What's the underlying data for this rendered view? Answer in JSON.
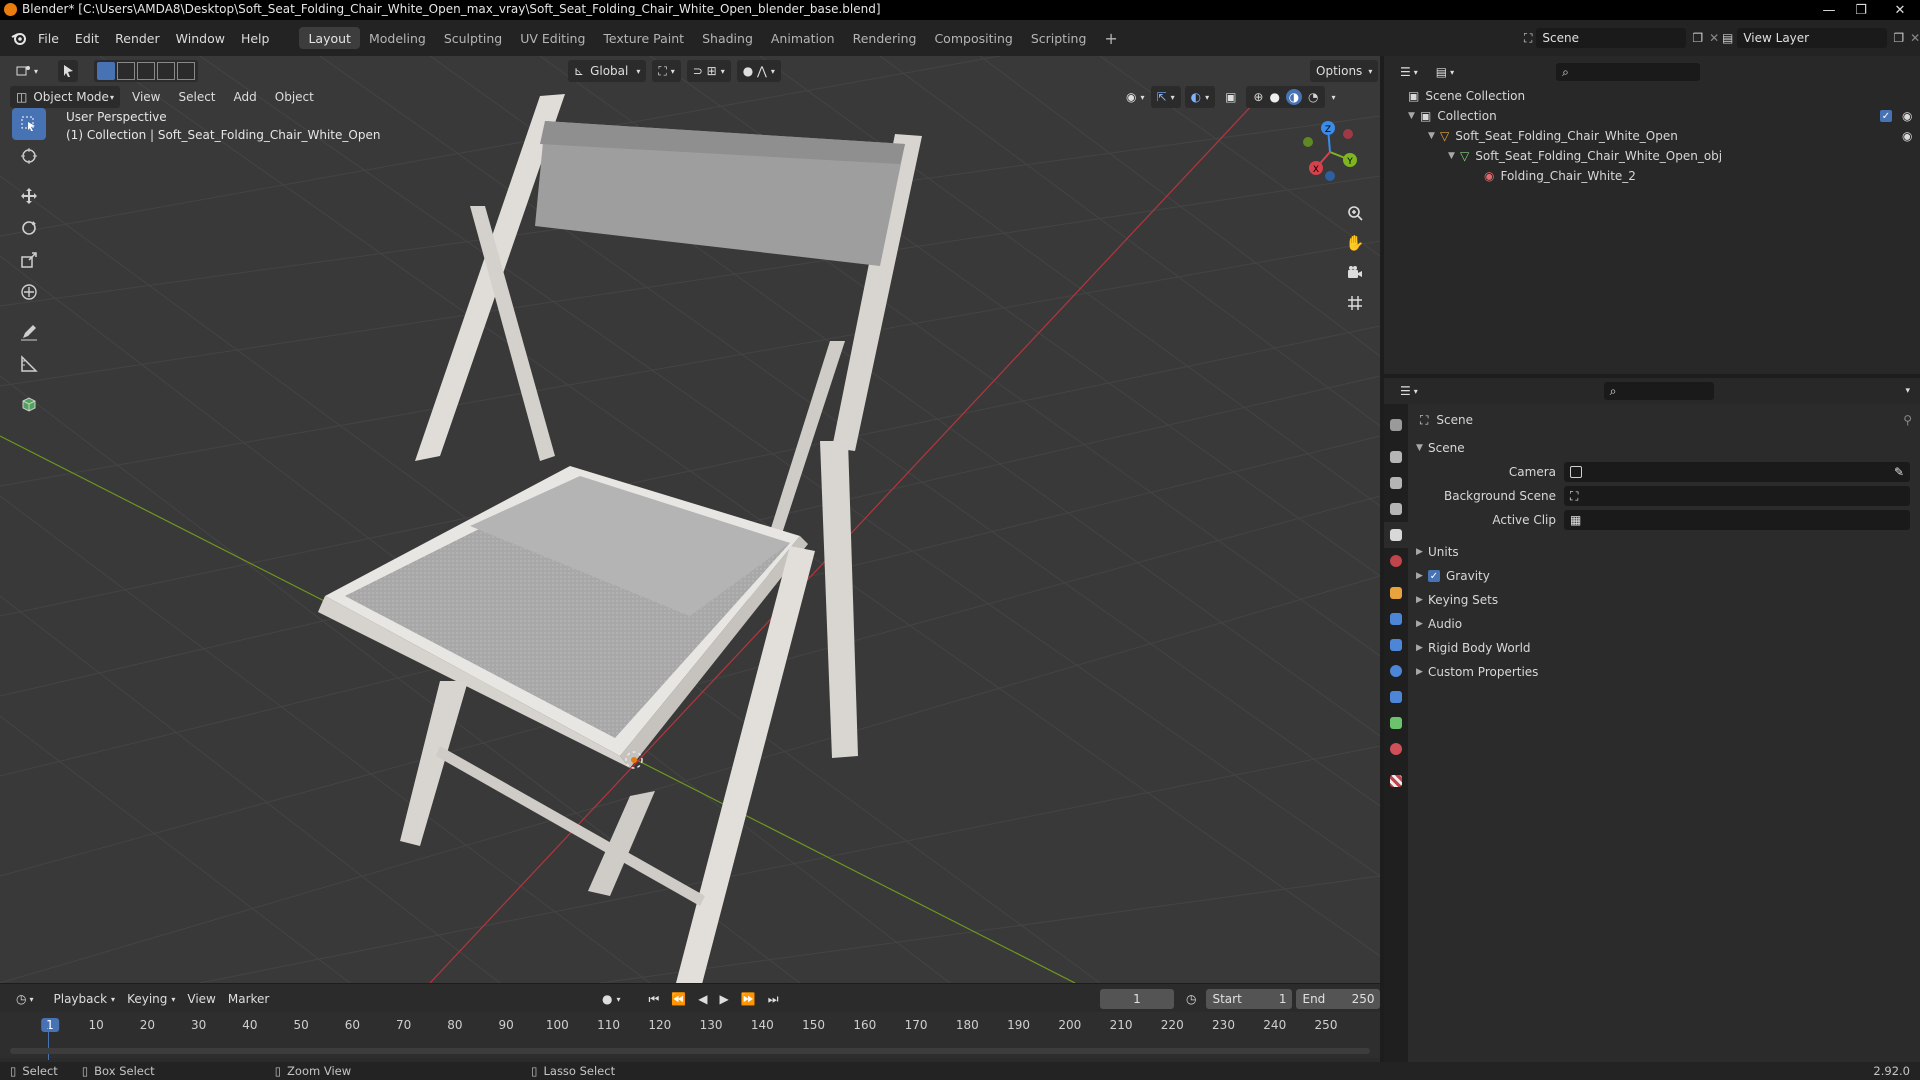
{
  "titlebar": {
    "title": "Blender* [C:\\Users\\AMDA8\\Desktop\\Soft_Seat_Folding_Chair_White_Open_max_vray\\Soft_Seat_Folding_Chair_White_Open_blender_base.blend]",
    "minimize": "—",
    "maximize": "❐",
    "close": "✕"
  },
  "menu": [
    "File",
    "Edit",
    "Render",
    "Window",
    "Help"
  ],
  "workspaces": [
    {
      "label": "Layout",
      "active": true
    },
    {
      "label": "Modeling"
    },
    {
      "label": "Sculpting"
    },
    {
      "label": "UV Editing"
    },
    {
      "label": "Texture Paint"
    },
    {
      "label": "Shading"
    },
    {
      "label": "Animation"
    },
    {
      "label": "Rendering"
    },
    {
      "label": "Compositing"
    },
    {
      "label": "Scripting"
    }
  ],
  "add_workspace": "+",
  "scene_selector": "Scene",
  "view_layer_selector": "View Layer",
  "viewport": {
    "transform_orientation": "Global",
    "options": "Options",
    "mode": "Object Mode",
    "menus": [
      "View",
      "Select",
      "Add",
      "Object"
    ],
    "overlay_line1": "User Perspective",
    "overlay_line2": "(1) Collection | Soft_Seat_Folding_Chair_White_Open",
    "gizmo": {
      "x": "X",
      "y": "Y",
      "z": "Z"
    }
  },
  "outliner": {
    "rows": [
      {
        "label": "Scene Collection"
      },
      {
        "label": "Collection"
      },
      {
        "label": "Soft_Seat_Folding_Chair_White_Open"
      },
      {
        "label": "Soft_Seat_Folding_Chair_White_Open_obj"
      },
      {
        "label": "Folding_Chair_White_2"
      }
    ]
  },
  "properties": {
    "context": "Scene",
    "panel": "Scene",
    "fields": [
      {
        "label": "Camera",
        "value": ""
      },
      {
        "label": "Background Scene",
        "value": ""
      },
      {
        "label": "Active Clip",
        "value": ""
      }
    ],
    "sections": [
      "Units",
      "Gravity",
      "Keying Sets",
      "Audio",
      "Rigid Body World",
      "Custom Properties"
    ],
    "gravity_enabled": true
  },
  "timeline": {
    "menus": [
      "Playback",
      "Keying",
      "View",
      "Marker"
    ],
    "current_frame": "1",
    "start_label": "Start",
    "start": "1",
    "end_label": "End",
    "end": "250",
    "ticks": [
      "1",
      "10",
      "20",
      "30",
      "40",
      "50",
      "60",
      "70",
      "80",
      "90",
      "100",
      "110",
      "120",
      "130",
      "140",
      "150",
      "160",
      "170",
      "180",
      "190",
      "200",
      "210",
      "220",
      "230",
      "240",
      "250"
    ]
  },
  "statusbar": {
    "select": "Select",
    "box_select": "Box Select",
    "zoom_view": "Zoom View",
    "lasso_select": "Lasso Select",
    "version": "2.92.0"
  },
  "colors": {
    "accent": "#4772b3",
    "x_axis": "#d6414b",
    "y_axis": "#7eb621",
    "z_axis": "#3b8be8",
    "origin": "#e87d0d"
  }
}
